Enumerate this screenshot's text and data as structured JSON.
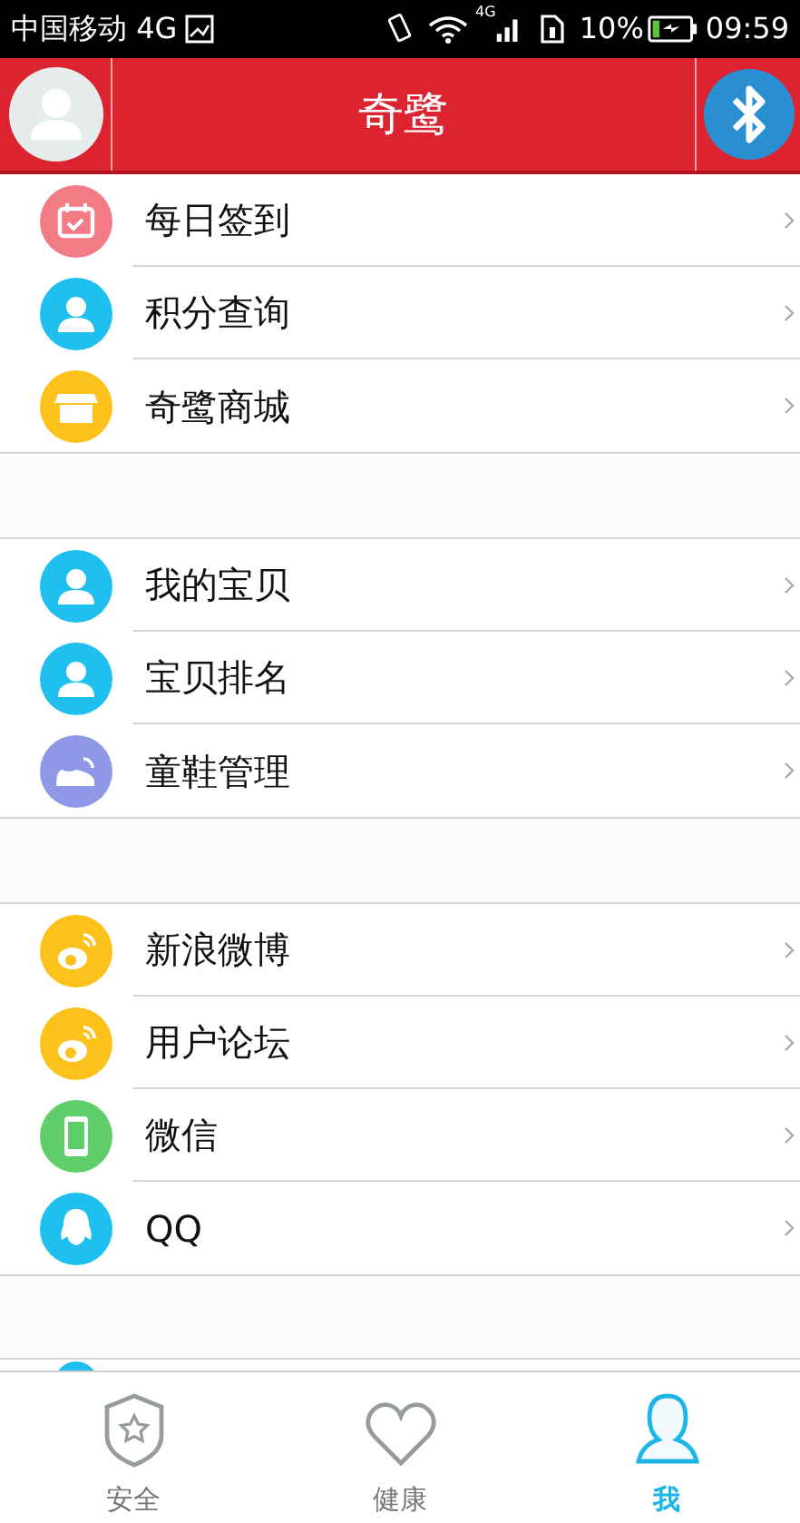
{
  "status_bar": {
    "carrier": "中国移动 4G",
    "network": "4G",
    "battery": "10%",
    "time": "09:59"
  },
  "header": {
    "title": "奇鹭"
  },
  "groups": [
    {
      "items": [
        {
          "label": "每日签到",
          "color": "#f27b86"
        },
        {
          "label": "积分查询",
          "color": "#1fc0f0"
        },
        {
          "label": "奇鹭商城",
          "color": "#fcc11a"
        }
      ]
    },
    {
      "items": [
        {
          "label": "我的宝贝",
          "color": "#1fc0f0"
        },
        {
          "label": "宝贝排名",
          "color": "#1fc0f0"
        },
        {
          "label": "童鞋管理",
          "color": "#8e98e6"
        }
      ]
    },
    {
      "items": [
        {
          "label": "新浪微博",
          "color": "#fcc11a"
        },
        {
          "label": "用户论坛",
          "color": "#fcc11a"
        },
        {
          "label": "微信",
          "color": "#5fcd6a"
        },
        {
          "label": "QQ",
          "color": "#1fc0f0"
        }
      ]
    }
  ],
  "tabs": [
    {
      "label": "安全",
      "selected": false
    },
    {
      "label": "健康",
      "selected": false
    },
    {
      "label": "我",
      "selected": true
    }
  ]
}
